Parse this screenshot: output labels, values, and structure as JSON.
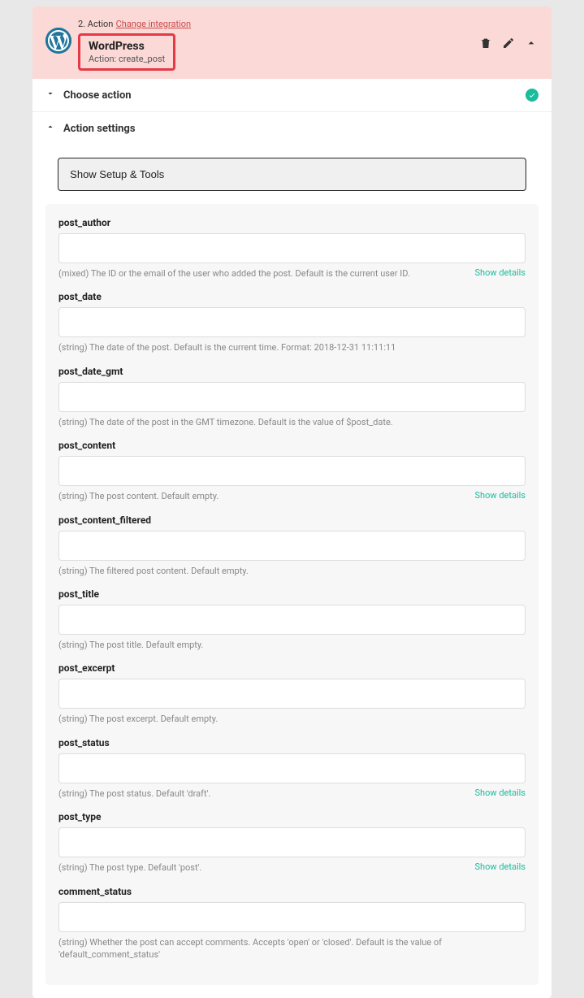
{
  "header": {
    "step_label": "2. Action",
    "change_link": "Change integration",
    "title": "WordPress",
    "subtitle": "Action: create_post"
  },
  "sections": {
    "choose_action": "Choose action",
    "action_settings": "Action settings"
  },
  "setup_button": "Show Setup & Tools",
  "show_details": "Show details",
  "fields": [
    {
      "key": "post_author",
      "label": "post_author",
      "desc": "(mixed) The ID or the email of the user who added the post. Default is the current user ID.",
      "show_details": true
    },
    {
      "key": "post_date",
      "label": "post_date",
      "desc": "(string) The date of the post. Default is the current time. Format: 2018-12-31 11:11:11",
      "show_details": false
    },
    {
      "key": "post_date_gmt",
      "label": "post_date_gmt",
      "desc": "(string) The date of the post in the GMT timezone. Default is the value of $post_date.",
      "show_details": false
    },
    {
      "key": "post_content",
      "label": "post_content",
      "desc": "(string) The post content. Default empty.",
      "show_details": true
    },
    {
      "key": "post_content_filtered",
      "label": "post_content_filtered",
      "desc": "(string) The filtered post content. Default empty.",
      "show_details": false
    },
    {
      "key": "post_title",
      "label": "post_title",
      "desc": "(string) The post title. Default empty.",
      "show_details": false
    },
    {
      "key": "post_excerpt",
      "label": "post_excerpt",
      "desc": "(string) The post excerpt. Default empty.",
      "show_details": false
    },
    {
      "key": "post_status",
      "label": "post_status",
      "desc": "(string) The post status. Default 'draft'.",
      "show_details": true
    },
    {
      "key": "post_type",
      "label": "post_type",
      "desc": "(string) The post type. Default 'post'.",
      "show_details": true
    },
    {
      "key": "comment_status",
      "label": "comment_status",
      "desc": "(string) Whether the post can accept comments. Accepts 'open' or 'closed'. Default is the value of 'default_comment_status'",
      "show_details": false
    }
  ]
}
